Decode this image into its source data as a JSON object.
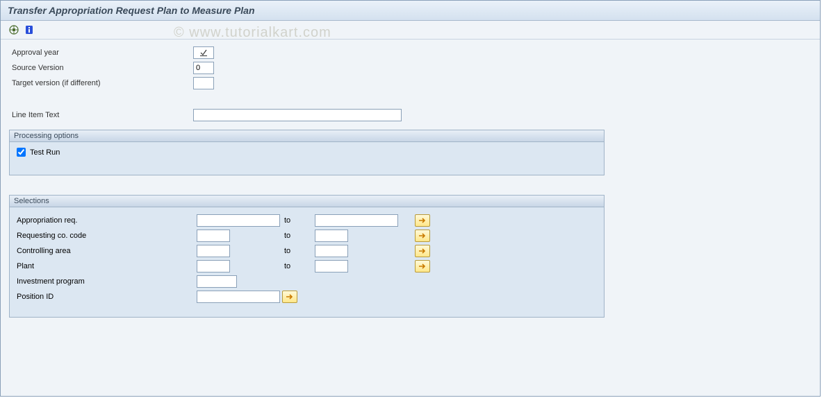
{
  "header": {
    "title": "Transfer Appropriation Request Plan to Measure Plan"
  },
  "watermark": "© www.tutorialkart.com",
  "fields": {
    "approval_year_label": "Approval year",
    "approval_year_value": "",
    "source_version_label": "Source Version",
    "source_version_value": "0",
    "target_version_label": "Target version (if different)",
    "target_version_value": "",
    "line_item_text_label": "Line Item Text",
    "line_item_text_value": ""
  },
  "processing": {
    "group_title": "Processing options",
    "test_run_label": "Test Run",
    "test_run_checked": true
  },
  "selections": {
    "group_title": "Selections",
    "to_label": "to",
    "rows": {
      "approp_req_label": "Appropriation req.",
      "approp_req_from": "",
      "approp_req_to": "",
      "req_co_code_label": "Requesting co. code",
      "req_co_code_from": "",
      "req_co_code_to": "",
      "controlling_area_label": "Controlling area",
      "controlling_area_from": "",
      "controlling_area_to": "",
      "plant_label": "Plant",
      "plant_from": "",
      "plant_to": "",
      "inv_program_label": "Investment program",
      "inv_program_value": "",
      "position_id_label": "Position ID",
      "position_id_value": ""
    }
  }
}
